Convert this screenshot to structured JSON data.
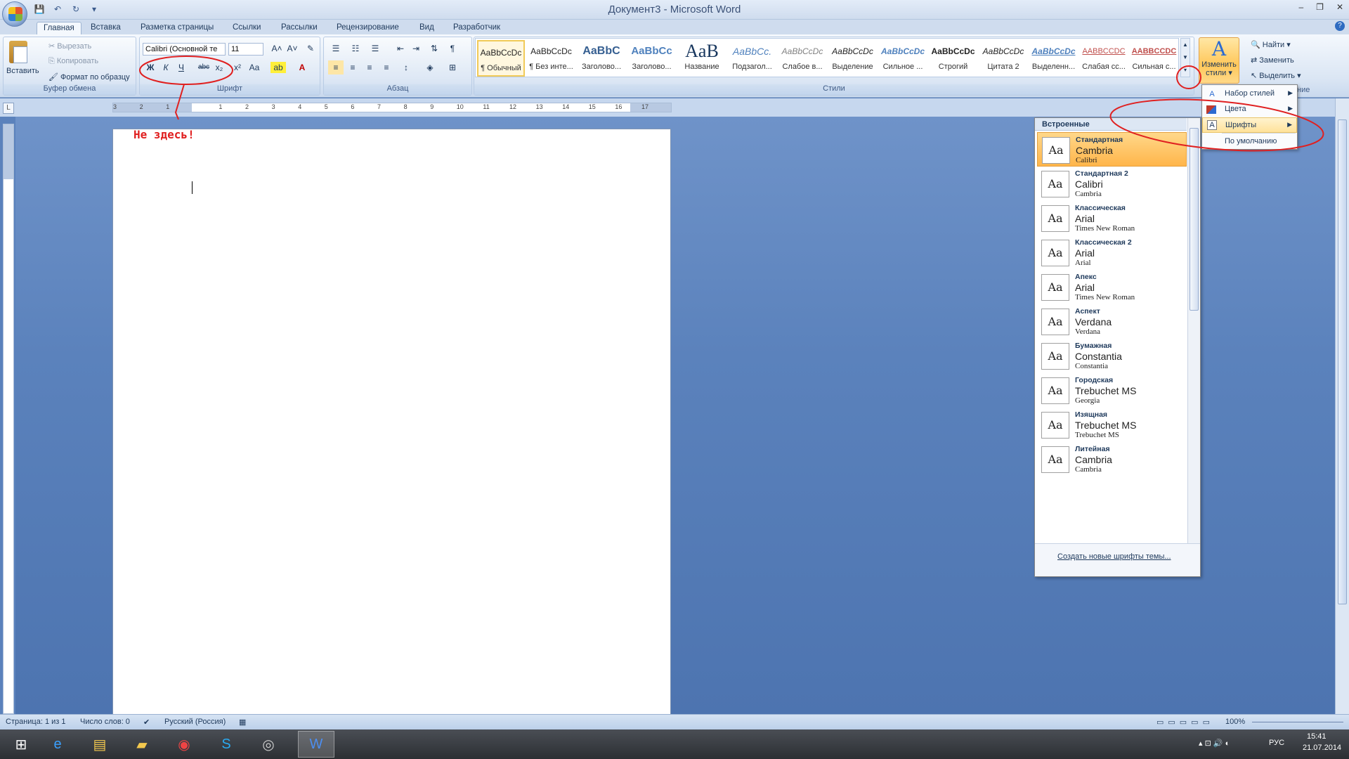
{
  "window": {
    "title": "Документ3 - Microsoft Word",
    "minimize": "–",
    "restore": "❐",
    "close": "✕"
  },
  "qat": {
    "save": "💾",
    "undo": "↶",
    "redo": "↻",
    "customize": "▾"
  },
  "tabs": [
    "Главная",
    "Вставка",
    "Разметка страницы",
    "Ссылки",
    "Рассылки",
    "Рецензирование",
    "Вид",
    "Разработчик"
  ],
  "clipboard": {
    "paste": "Вставить",
    "cut": "Вырезать",
    "copy": "Копировать",
    "format_painter": "Формат по образцу",
    "group": "Буфер обмена"
  },
  "font": {
    "name": "Calibri (Основной те",
    "size": "11",
    "group": "Шрифт",
    "bold": "Ж",
    "italic": "К",
    "underline": "Ч",
    "strike": "abc",
    "subscript": "x₂",
    "superscript": "x²",
    "case": "Aa",
    "grow": "A˄",
    "shrink": "A˅",
    "clear": "✎",
    "highlight": "ab",
    "color": "A"
  },
  "paragraph": {
    "group": "Абзац"
  },
  "styles": {
    "group": "Стили",
    "items": [
      {
        "sample": "AaBbCcDc",
        "name": "¶ Обычный"
      },
      {
        "sample": "AaBbCcDc",
        "name": "¶ Без инте..."
      },
      {
        "sample": "AaBbC",
        "name": "Заголово..."
      },
      {
        "sample": "AaBbCc",
        "name": "Заголово..."
      },
      {
        "sample": "AaB",
        "name": "Название"
      },
      {
        "sample": "AaBbCc.",
        "name": "Подзагол..."
      },
      {
        "sample": "AaBbCcDc",
        "name": "Слабое в..."
      },
      {
        "sample": "AaBbCcDc",
        "name": "Выделение"
      },
      {
        "sample": "AaBbCcDc",
        "name": "Сильное ..."
      },
      {
        "sample": "AaBbCcDc",
        "name": "Строгий"
      },
      {
        "sample": "AaBbCcDc",
        "name": "Цитата 2"
      },
      {
        "sample": "AaBbCcDc",
        "name": "Выделенн..."
      },
      {
        "sample": "AABBCCDC",
        "name": "Слабая сс..."
      },
      {
        "sample": "AABBCCDC",
        "name": "Сильная с..."
      }
    ]
  },
  "change_styles": {
    "icon": "A",
    "line1": "Изменить",
    "line2": "стили ▾"
  },
  "editing": {
    "find": "Найти ▾",
    "replace": "Заменить",
    "select": "Выделить ▾",
    "group_fragment": "ние"
  },
  "ruler": {
    "corner": "L"
  },
  "status": {
    "page": "Страница: 1 из 1",
    "words": "Число слов: 0",
    "language": "Русский (Россия)",
    "zoom": "100%"
  },
  "taskbar": {
    "lang": "РУС",
    "time": "15:41",
    "date": "21.07.2014"
  },
  "fonts_panel": {
    "header": "Встроенные",
    "items": [
      {
        "name": "Стандартная",
        "heading": "Cambria",
        "body": "Calibri"
      },
      {
        "name": "Стандартная 2",
        "heading": "Calibri",
        "body": "Cambria"
      },
      {
        "name": "Классическая",
        "heading": "Arial",
        "body": "Times New Roman"
      },
      {
        "name": "Классическая 2",
        "heading": "Arial",
        "body": "Arial"
      },
      {
        "name": "Апекс",
        "heading": "Arial",
        "body": "Times New Roman"
      },
      {
        "name": "Аспект",
        "heading": "Verdana",
        "body": "Verdana"
      },
      {
        "name": "Бумажная",
        "heading": "Constantia",
        "body": "Constantia"
      },
      {
        "name": "Городская",
        "heading": "Trebuchet MS",
        "body": "Georgia"
      },
      {
        "name": "Изящная",
        "heading": "Trebuchet MS",
        "body": "Trebuchet MS"
      },
      {
        "name": "Литейная",
        "heading": "Cambria",
        "body": "Cambria"
      }
    ],
    "aa": "Aa",
    "create": "Создать новые шрифты темы..."
  },
  "menu": {
    "items": [
      "Набор стилей",
      "Цвета",
      "Шрифты",
      "По умолчанию"
    ]
  },
  "annotation": {
    "text": "Не здесь!"
  },
  "colors": {
    "accent": "#2c6bd1",
    "annotation": "#e02020",
    "highlight": "#ffc75a"
  }
}
